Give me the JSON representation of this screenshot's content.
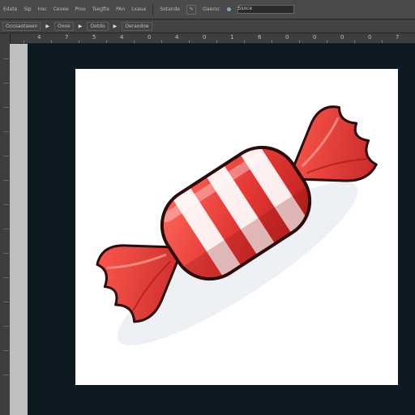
{
  "menubar": {
    "items": [
      {
        "label": "Edate",
        "name": "menu-edate"
      },
      {
        "label": "Sip",
        "name": "menu-sip"
      },
      {
        "label": "Irec",
        "name": "menu-irec"
      },
      {
        "label": "Cevee",
        "name": "menu-cevee"
      },
      {
        "label": "Pmo",
        "name": "menu-pmo"
      },
      {
        "label": "Tsegfte",
        "name": "menu-tsegfte"
      },
      {
        "label": "PAn",
        "name": "menu-pan"
      },
      {
        "label": "Lxaue",
        "name": "menu-lxaue"
      }
    ],
    "tools": [
      {
        "label": "Sotande",
        "name": "tool-sotande"
      },
      {
        "label": "Oaeroc",
        "name": "tool-oaeroc"
      }
    ],
    "field_label": "Ssoce"
  },
  "options": {
    "items": [
      {
        "label": "Ocosaotaeen",
        "name": "option-1"
      },
      {
        "label": "Oooe",
        "name": "option-2"
      },
      {
        "label": "Oetdo",
        "name": "option-3"
      },
      {
        "label": "Oeraodoe",
        "name": "option-4"
      }
    ]
  },
  "ruler": {
    "ticks": [
      "4",
      "7",
      "5",
      "4",
      "0",
      "4",
      "0",
      "1",
      "6",
      "0",
      "0",
      "0",
      "0",
      "7"
    ]
  },
  "canvas": {
    "image_subject": "wrapped-candy-illustration",
    "colors": {
      "wrapper_red": "#e53935",
      "stripe_white": "#ffffff",
      "outline": "#2b0b0b",
      "shadow": "#d6dbe6"
    }
  }
}
